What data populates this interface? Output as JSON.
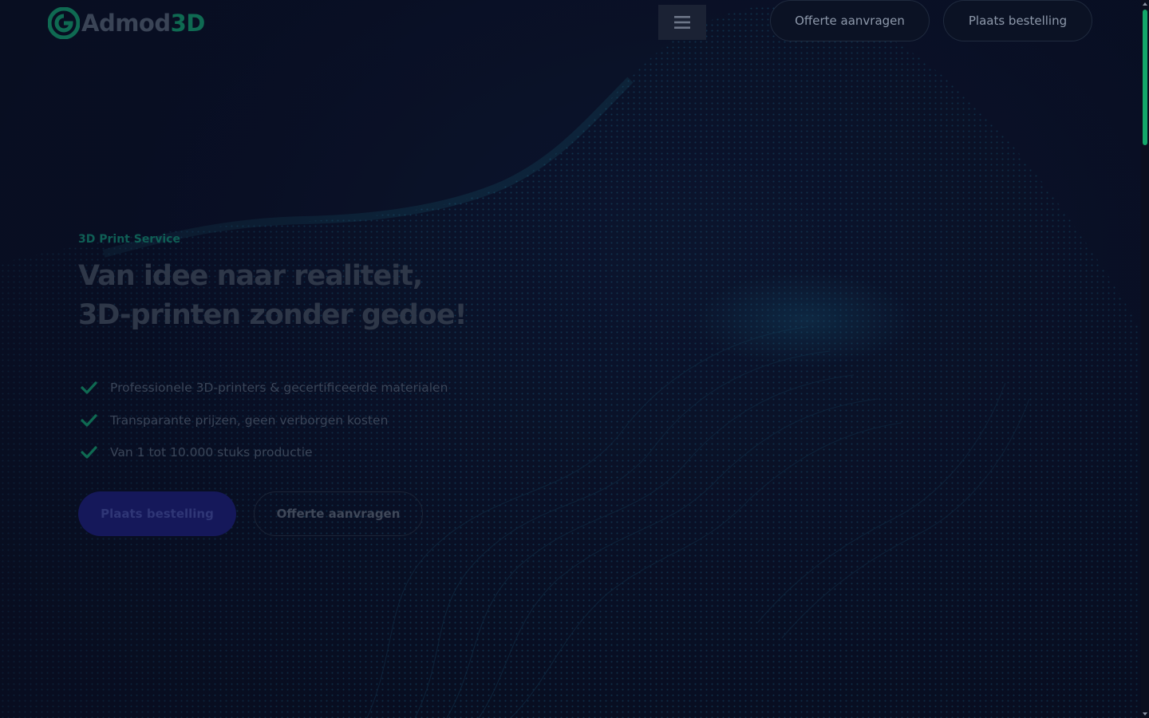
{
  "header": {
    "logo": {
      "text_main": "Admod",
      "text_accent": "3D"
    },
    "menu_icon": "hamburger-menu-icon",
    "quote_button_label": "Offerte aanvragen",
    "order_button_label": "Plaats bestelling"
  },
  "hero": {
    "eyebrow": "3D Print Service",
    "headline_line1": "Van idee naar realiteit,",
    "headline_line2": "3D-printen zonder gedoe!",
    "features": [
      {
        "icon": "check-icon",
        "text": "Professionele 3D-printers & gecertificeerde materialen"
      },
      {
        "icon": "check-icon",
        "text": "Transparante prijzen, geen verborgen kosten"
      },
      {
        "icon": "check-icon",
        "text": "Van 1 tot 10.000 stuks productie"
      }
    ],
    "primary_cta_label": "Plaats bestelling",
    "secondary_cta_label": "Offerte aanvragen"
  },
  "scrollbar": {
    "position_fraction": 0.0
  },
  "colors": {
    "background": "#0a1024",
    "brand_green": "#13a86a",
    "primary_button": "#15185a",
    "wave_dots": "#1b6f8a"
  }
}
